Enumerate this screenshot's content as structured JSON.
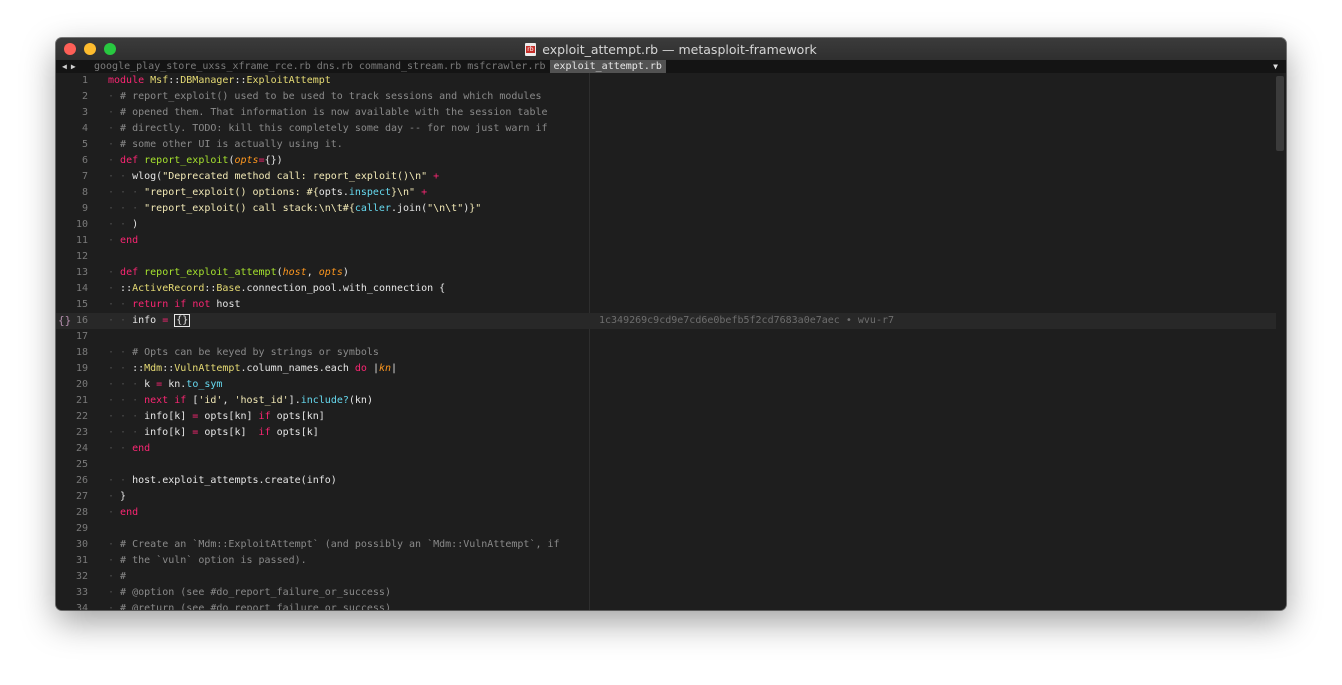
{
  "window": {
    "title": "exploit_attempt.rb — metasploit-framework"
  },
  "nav": {
    "back_icon": "◀",
    "forward_icon": "▶",
    "menu_icon": "▼"
  },
  "tabs": [
    {
      "label": "google_play_store_uxss_xframe_rce.rb",
      "active": false
    },
    {
      "label": "dns.rb",
      "active": false
    },
    {
      "label": "command_stream.rb",
      "active": false
    },
    {
      "label": "msfcrawler.rb",
      "active": false
    },
    {
      "label": "exploit_attempt.rb",
      "active": true
    }
  ],
  "editor": {
    "current_line": 16,
    "gutter_marker": "{}",
    "blame": "1c349269c9cd9e7cd6e0befb5f2cd7683a0e7aec • wvu-r7",
    "colors": {
      "keyword": "#f92672",
      "constant": "#e6db74",
      "comment": "#8a8a8a",
      "string": "#f2e9b6",
      "function": "#a6e22e",
      "param": "#fd971f",
      "builtin": "#66d9ef",
      "symbol": "#ae81ff",
      "plain": "#e6e6e6"
    },
    "lines": [
      {
        "n": "1",
        "tokens": [
          [
            "keyword",
            "module"
          ],
          [
            "plain",
            " "
          ],
          [
            "const",
            "Msf"
          ],
          [
            "plain",
            "::"
          ],
          [
            "const",
            "DBManager"
          ],
          [
            "plain",
            "::"
          ],
          [
            "const",
            "ExploitAttempt"
          ]
        ]
      },
      {
        "n": "2",
        "tokens": [
          [
            "guide",
            "  "
          ],
          [
            "comment",
            "# report_exploit() used to be used to track sessions and which modules"
          ]
        ]
      },
      {
        "n": "3",
        "tokens": [
          [
            "guide",
            "  "
          ],
          [
            "comment",
            "# opened them. That information is now available with the session table"
          ]
        ]
      },
      {
        "n": "4",
        "tokens": [
          [
            "guide",
            "  "
          ],
          [
            "comment",
            "# directly. TODO: kill this completely some day -- for now just warn if"
          ]
        ]
      },
      {
        "n": "5",
        "tokens": [
          [
            "guide",
            "  "
          ],
          [
            "comment",
            "# some other UI is actually using it."
          ]
        ]
      },
      {
        "n": "6",
        "tokens": [
          [
            "guide",
            "  "
          ],
          [
            "keyword",
            "def"
          ],
          [
            "plain",
            " "
          ],
          [
            "func",
            "report_exploit"
          ],
          [
            "plain",
            "("
          ],
          [
            "param",
            "opts"
          ],
          [
            "keyword",
            "="
          ],
          [
            "plain",
            "{})"
          ]
        ]
      },
      {
        "n": "7",
        "tokens": [
          [
            "guide",
            "    "
          ],
          [
            "plain",
            "wlog("
          ],
          [
            "string",
            "\"Deprecated method call: report_exploit()\\n\""
          ],
          [
            "plain",
            " "
          ],
          [
            "keyword",
            "+"
          ]
        ]
      },
      {
        "n": "8",
        "tokens": [
          [
            "guide",
            "      "
          ],
          [
            "string",
            "\"report_exploit() options: #{"
          ],
          [
            "plain",
            "opts."
          ],
          [
            "builtin",
            "inspect"
          ],
          [
            "string",
            "}\\n\""
          ],
          [
            "plain",
            " "
          ],
          [
            "keyword",
            "+"
          ]
        ]
      },
      {
        "n": "9",
        "tokens": [
          [
            "guide",
            "      "
          ],
          [
            "string",
            "\"report_exploit() call stack:\\n\\t#{"
          ],
          [
            "builtin",
            "caller"
          ],
          [
            "plain",
            ".join("
          ],
          [
            "string",
            "\"\\n\\t\""
          ],
          [
            "plain",
            ")"
          ],
          [
            "string",
            "}\""
          ]
        ]
      },
      {
        "n": "10",
        "tokens": [
          [
            "guide",
            "    "
          ],
          [
            "plain",
            ")"
          ]
        ]
      },
      {
        "n": "11",
        "tokens": [
          [
            "guide",
            "  "
          ],
          [
            "keyword",
            "end"
          ]
        ]
      },
      {
        "n": "12",
        "tokens": []
      },
      {
        "n": "13",
        "tokens": [
          [
            "guide",
            "  "
          ],
          [
            "keyword",
            "def"
          ],
          [
            "plain",
            " "
          ],
          [
            "func",
            "report_exploit_attempt"
          ],
          [
            "plain",
            "("
          ],
          [
            "param",
            "host"
          ],
          [
            "plain",
            ", "
          ],
          [
            "param",
            "opts"
          ],
          [
            "plain",
            ")"
          ]
        ]
      },
      {
        "n": "14",
        "tokens": [
          [
            "guide",
            "  "
          ],
          [
            "plain",
            "::"
          ],
          [
            "const",
            "ActiveRecord"
          ],
          [
            "plain",
            "::"
          ],
          [
            "const",
            "Base"
          ],
          [
            "plain",
            ".connection_pool.with_connection {"
          ]
        ]
      },
      {
        "n": "15",
        "tokens": [
          [
            "guide",
            "    "
          ],
          [
            "keyword",
            "return"
          ],
          [
            "plain",
            " "
          ],
          [
            "keyword",
            "if"
          ],
          [
            "plain",
            " "
          ],
          [
            "keyword",
            "not"
          ],
          [
            "plain",
            " host"
          ]
        ]
      },
      {
        "n": "16",
        "tokens": [
          [
            "guide",
            "    "
          ],
          [
            "plain",
            "info "
          ],
          [
            "keyword",
            "="
          ],
          [
            "plain",
            " "
          ],
          [
            "cursor",
            "{}"
          ]
        ]
      },
      {
        "n": "17",
        "tokens": []
      },
      {
        "n": "18",
        "tokens": [
          [
            "guide",
            "    "
          ],
          [
            "comment",
            "# Opts can be keyed by strings or symbols"
          ]
        ]
      },
      {
        "n": "19",
        "tokens": [
          [
            "guide",
            "    "
          ],
          [
            "plain",
            "::"
          ],
          [
            "const",
            "Mdm"
          ],
          [
            "plain",
            "::"
          ],
          [
            "const",
            "VulnAttempt"
          ],
          [
            "plain",
            ".column_names.each "
          ],
          [
            "keyword",
            "do"
          ],
          [
            "plain",
            " |"
          ],
          [
            "param",
            "kn"
          ],
          [
            "plain",
            "|"
          ]
        ]
      },
      {
        "n": "20",
        "tokens": [
          [
            "guide",
            "      "
          ],
          [
            "plain",
            "k "
          ],
          [
            "keyword",
            "="
          ],
          [
            "plain",
            " kn."
          ],
          [
            "builtin",
            "to_sym"
          ]
        ]
      },
      {
        "n": "21",
        "tokens": [
          [
            "guide",
            "      "
          ],
          [
            "keyword",
            "next"
          ],
          [
            "plain",
            " "
          ],
          [
            "keyword",
            "if"
          ],
          [
            "plain",
            " ["
          ],
          [
            "string",
            "'id'"
          ],
          [
            "plain",
            ", "
          ],
          [
            "string",
            "'host_id'"
          ],
          [
            "plain",
            "]."
          ],
          [
            "builtin",
            "include?"
          ],
          [
            "plain",
            "(kn)"
          ]
        ]
      },
      {
        "n": "22",
        "tokens": [
          [
            "guide",
            "      "
          ],
          [
            "plain",
            "info[k] "
          ],
          [
            "keyword",
            "="
          ],
          [
            "plain",
            " opts[kn] "
          ],
          [
            "keyword",
            "if"
          ],
          [
            "plain",
            " opts[kn]"
          ]
        ]
      },
      {
        "n": "23",
        "tokens": [
          [
            "guide",
            "      "
          ],
          [
            "plain",
            "info[k] "
          ],
          [
            "keyword",
            "="
          ],
          [
            "plain",
            " opts[k]  "
          ],
          [
            "keyword",
            "if"
          ],
          [
            "plain",
            " opts[k]"
          ]
        ]
      },
      {
        "n": "24",
        "tokens": [
          [
            "guide",
            "    "
          ],
          [
            "keyword",
            "end"
          ]
        ]
      },
      {
        "n": "25",
        "tokens": []
      },
      {
        "n": "26",
        "tokens": [
          [
            "guide",
            "    "
          ],
          [
            "plain",
            "host.exploit_attempts.create(info)"
          ]
        ]
      },
      {
        "n": "27",
        "tokens": [
          [
            "guide",
            "  "
          ],
          [
            "plain",
            "}"
          ]
        ]
      },
      {
        "n": "28",
        "tokens": [
          [
            "guide",
            "  "
          ],
          [
            "keyword",
            "end"
          ]
        ]
      },
      {
        "n": "29",
        "tokens": []
      },
      {
        "n": "30",
        "tokens": [
          [
            "guide",
            "  "
          ],
          [
            "comment",
            "# Create an `Mdm::ExploitAttempt` (and possibly an `Mdm::VulnAttempt`, if"
          ]
        ]
      },
      {
        "n": "31",
        "tokens": [
          [
            "guide",
            "  "
          ],
          [
            "comment",
            "# the `vuln` option is passed)."
          ]
        ]
      },
      {
        "n": "32",
        "tokens": [
          [
            "guide",
            "  "
          ],
          [
            "comment",
            "#"
          ]
        ]
      },
      {
        "n": "33",
        "tokens": [
          [
            "guide",
            "  "
          ],
          [
            "comment",
            "# @option (see #do_report_failure_or_success)"
          ]
        ]
      },
      {
        "n": "34",
        "tokens": [
          [
            "guide",
            "  "
          ],
          [
            "comment",
            "# @return (see #do_report_failure_or_success)"
          ]
        ]
      }
    ]
  }
}
